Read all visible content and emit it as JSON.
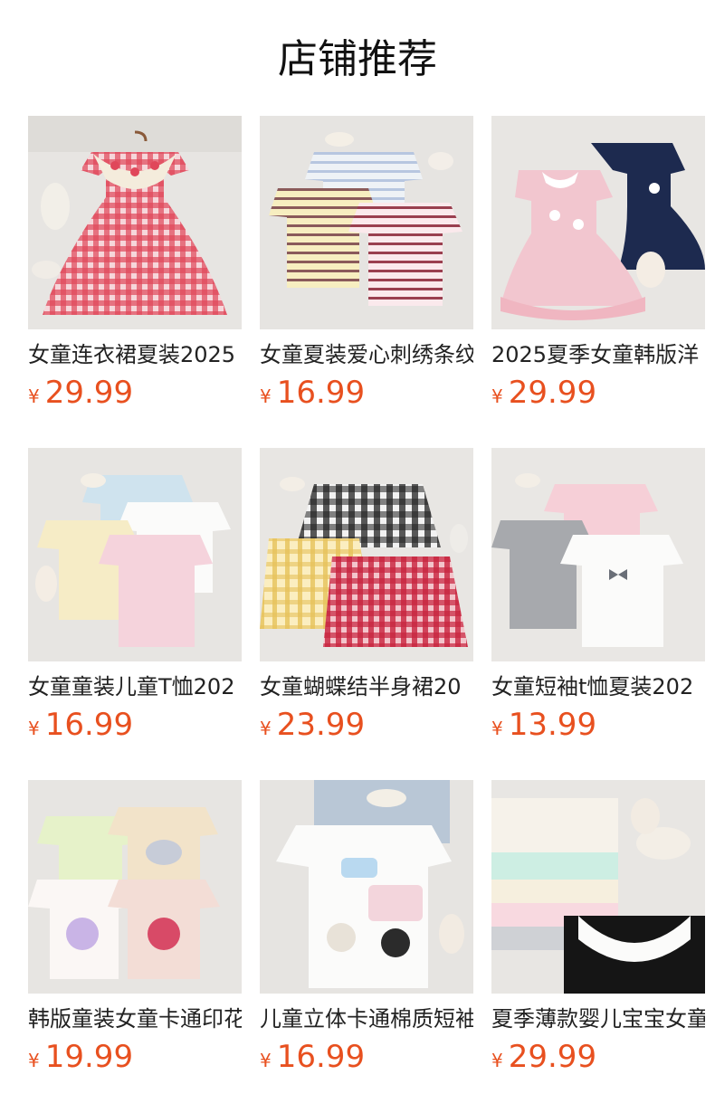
{
  "header": {
    "title": "店铺推荐"
  },
  "currency_symbol": "¥",
  "colors": {
    "price": "#e8501f"
  },
  "products": [
    {
      "name": "女童连衣裙夏装2025",
      "price": "29.99",
      "image_icon": "red-gingham-dress-photo"
    },
    {
      "name": "女童夏装爱心刺绣条纹",
      "price": "16.99",
      "image_icon": "striped-tshirts-photo"
    },
    {
      "name": "2025夏季女童韩版洋",
      "price": "29.99",
      "image_icon": "pink-navy-dresses-photo"
    },
    {
      "name": "女童童装儿童T恤202",
      "price": "16.99",
      "image_icon": "pastel-tshirts-photo"
    },
    {
      "name": "女童蝴蝶结半身裙20",
      "price": "23.99",
      "image_icon": "plaid-skirts-photo"
    },
    {
      "name": "女童短袖t恤夏装202",
      "price": "13.99",
      "image_icon": "bow-tshirts-photo"
    },
    {
      "name": "韩版童装女童卡通印花",
      "price": "19.99",
      "image_icon": "cartoon-print-tshirts-photo"
    },
    {
      "name": "儿童立体卡通棉质短袖",
      "price": "16.99",
      "image_icon": "white-cartoon-tshirt-photo"
    },
    {
      "name": "夏季薄款婴儿宝宝女童",
      "price": "29.99",
      "image_icon": "lace-collar-cardigans-photo"
    }
  ]
}
